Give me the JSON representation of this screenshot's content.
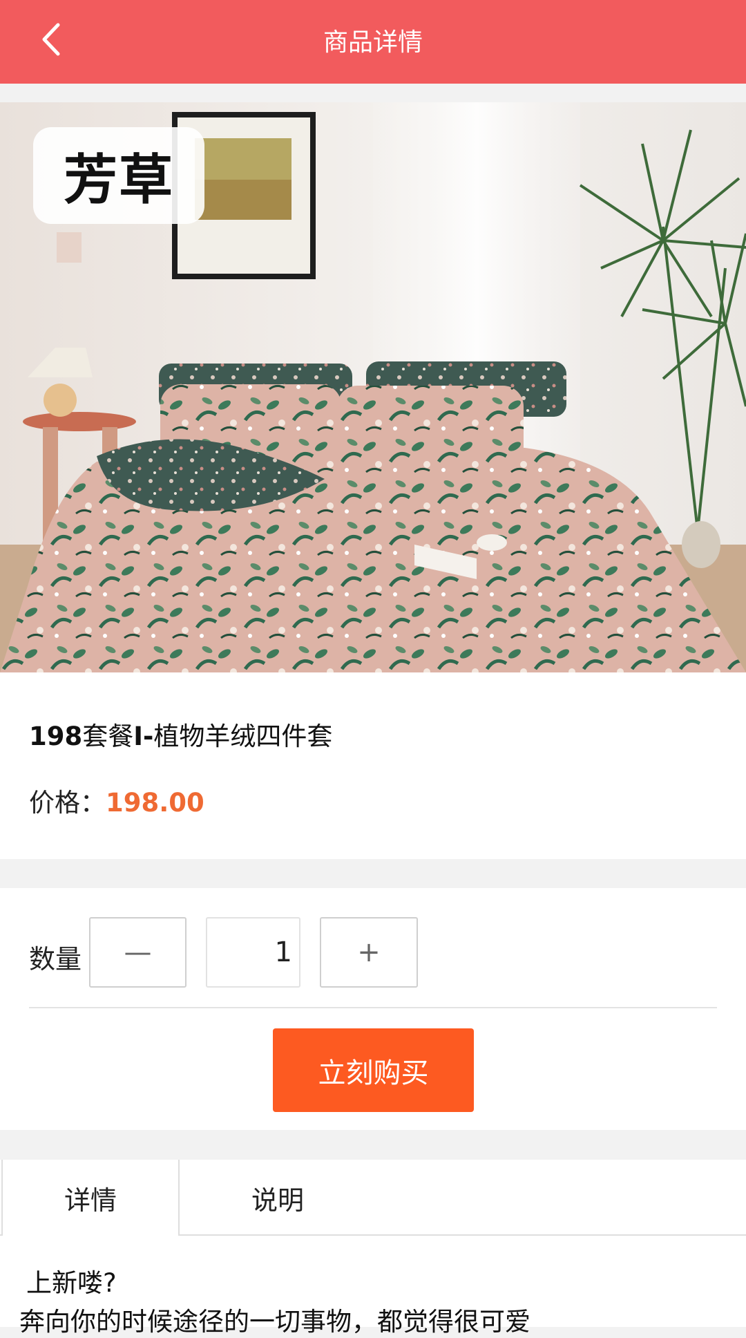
{
  "header": {
    "title": "商品详情",
    "back_icon": "chevron-left-icon",
    "bg_color": "#f25b5d"
  },
  "hero": {
    "brand_tag": "芳草"
  },
  "product": {
    "name_bold_prefix": "198",
    "name_middle": "套餐",
    "name_bold_mid": "I-",
    "name_suffix": "植物羊绒四件套",
    "price_label": "价格：",
    "price": "198.00",
    "price_color": "#ef6a33"
  },
  "quantity": {
    "label": "数量",
    "minus": "—",
    "value": "1",
    "plus": "+"
  },
  "buy_button": {
    "label": "立刻购买",
    "color": "#fd5a21"
  },
  "tabs": [
    {
      "label": "详情",
      "active": true
    },
    {
      "label": "说明",
      "active": false
    }
  ],
  "detail": {
    "line1": "上新喽?",
    "line2": "奔向你的时候途径的一切事物，都觉得很可爱"
  }
}
